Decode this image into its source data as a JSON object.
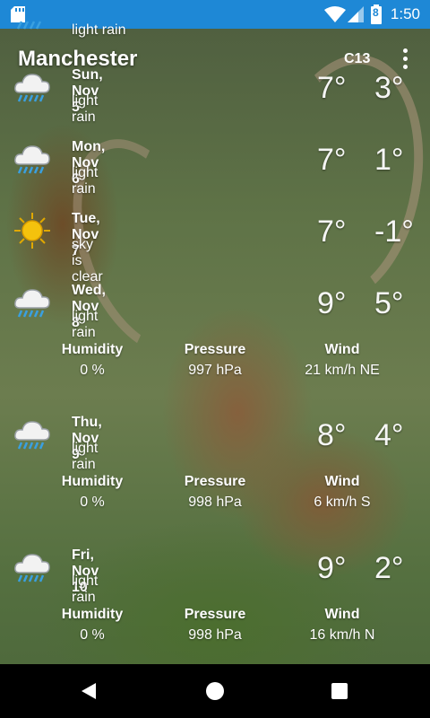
{
  "status_bar": {
    "time": "1:50",
    "battery_level": "8"
  },
  "header": {
    "city": "Manchester",
    "unit_toggle": "C13",
    "menu": "more-vert-icon"
  },
  "partial_row": {
    "desc": "light rain"
  },
  "days": [
    {
      "date": "Sun, Nov 5",
      "desc": "light rain",
      "high": "7°",
      "low": "3°",
      "icon": "rain-cloud-icon"
    },
    {
      "date": "Mon, Nov 6",
      "desc": "light rain",
      "high": "7°",
      "low": "1°",
      "icon": "rain-cloud-icon"
    },
    {
      "date": "Tue, Nov 7",
      "desc": "sky is clear",
      "high": "7°",
      "low": "-1°",
      "icon": "sun-icon"
    },
    {
      "date": "Wed, Nov 8",
      "desc": "light rain",
      "high": "9°",
      "low": "5°",
      "icon": "rain-cloud-icon",
      "details": {
        "humidity": "0 %",
        "pressure": "997 hPa",
        "wind": "21 km/h NE"
      }
    },
    {
      "date": "Thu, Nov 9",
      "desc": "light rain",
      "high": "8°",
      "low": "4°",
      "icon": "rain-cloud-icon",
      "details": {
        "humidity": "0 %",
        "pressure": "998 hPa",
        "wind": "6 km/h S"
      }
    },
    {
      "date": "Fri, Nov 10",
      "desc": "light rain",
      "high": "9°",
      "low": "2°",
      "icon": "rain-cloud-icon",
      "details": {
        "humidity": "0 %",
        "pressure": "998 hPa",
        "wind": "16 km/h N"
      }
    }
  ],
  "labels": {
    "humidity": "Humidity",
    "pressure": "Pressure",
    "wind": "Wind"
  },
  "colors": {
    "status_bar": "#1e88d6",
    "nav_bar": "#000000",
    "rain": "#3aa0e0",
    "sun": "#f4c20d"
  }
}
